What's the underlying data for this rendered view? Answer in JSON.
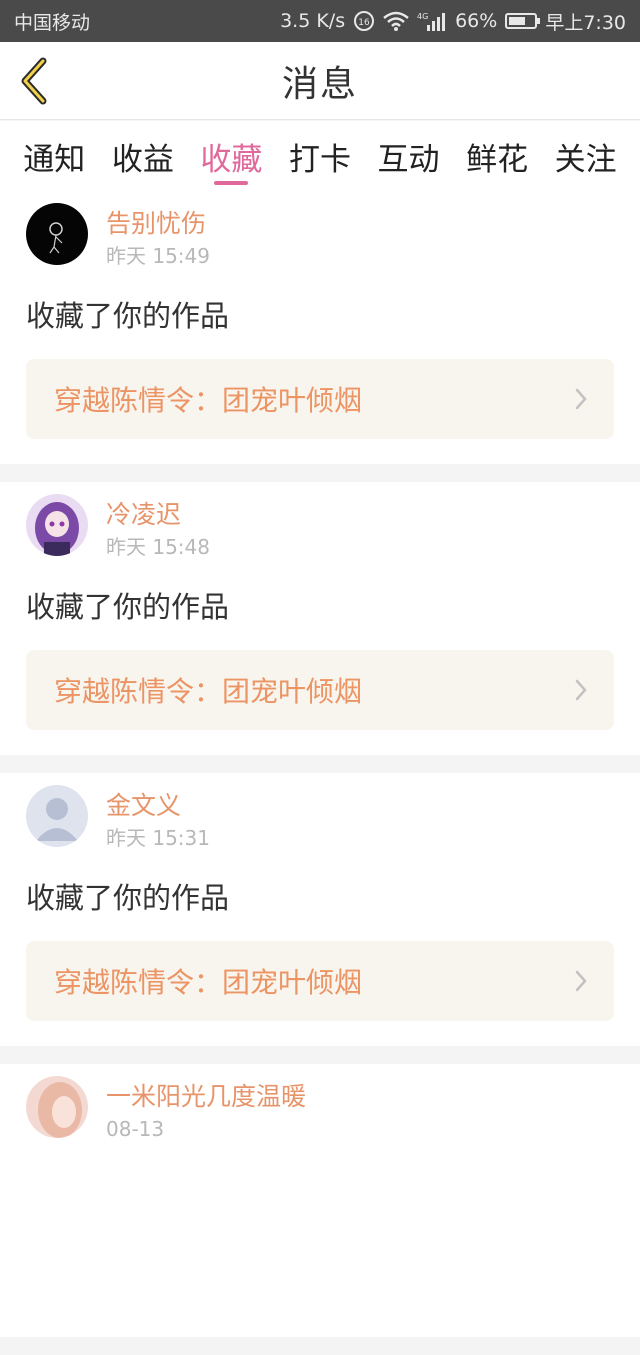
{
  "status_bar": {
    "carrier": "中国移动",
    "speed": "3.5 K/s",
    "network": "4G",
    "battery": "66%",
    "battery_level": 0.66,
    "time": "早上7:30"
  },
  "header": {
    "title": "消息"
  },
  "tabs": [
    {
      "label": "通知",
      "active": false
    },
    {
      "label": "收益",
      "active": false
    },
    {
      "label": "收藏",
      "active": true
    },
    {
      "label": "打卡",
      "active": false
    },
    {
      "label": "互动",
      "active": false
    },
    {
      "label": "鲜花",
      "active": false
    },
    {
      "label": "关注",
      "active": false
    }
  ],
  "messages": [
    {
      "user": "告别忧伤",
      "time": "昨天 15:49",
      "action": "收藏了你的作品",
      "work": "穿越陈情令：团宠叶倾烟"
    },
    {
      "user": "冷凌迟",
      "time": "昨天 15:48",
      "action": "收藏了你的作品",
      "work": "穿越陈情令：团宠叶倾烟"
    },
    {
      "user": "金文义",
      "time": "昨天 15:31",
      "action": "收藏了你的作品",
      "work": "穿越陈情令：团宠叶倾烟"
    },
    {
      "user": "一米阳光几度温暖",
      "time": "08-13",
      "action": "",
      "work": ""
    }
  ],
  "colors": {
    "accent": "#e0699c",
    "username": "#e8946a",
    "work_text": "#ec9464",
    "work_bg": "#f7f5ee"
  }
}
